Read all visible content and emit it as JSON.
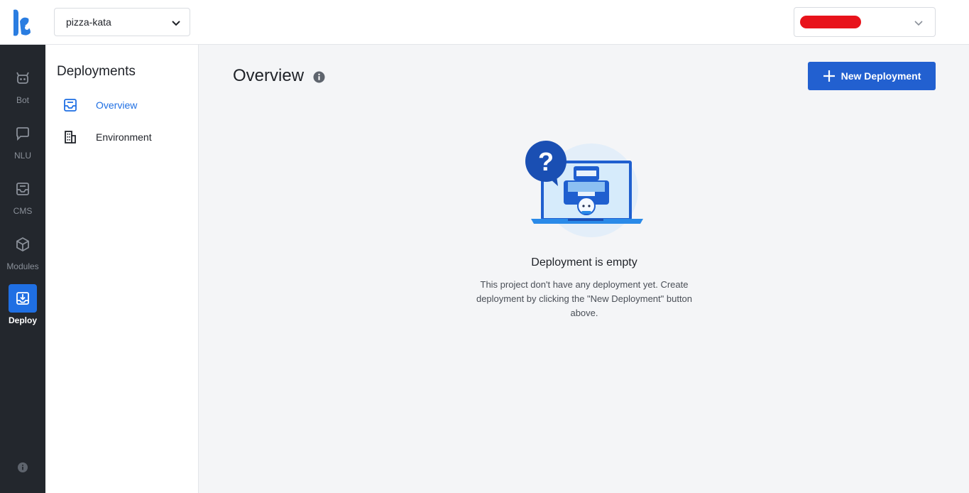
{
  "header": {
    "project": "pizza-kata",
    "user_redacted": true
  },
  "rail": {
    "items": [
      {
        "label": "Bot",
        "icon": "bot-icon"
      },
      {
        "label": "NLU",
        "icon": "chat-icon"
      },
      {
        "label": "CMS",
        "icon": "inbox-icon"
      },
      {
        "label": "Modules",
        "icon": "cube-icon"
      },
      {
        "label": "Deploy",
        "icon": "deploy-icon",
        "active": true
      }
    ]
  },
  "subnav": {
    "title": "Deployments",
    "items": [
      {
        "label": "Overview",
        "icon": "overview-icon",
        "active": true
      },
      {
        "label": "Environment",
        "icon": "building-icon"
      }
    ]
  },
  "main": {
    "title": "Overview",
    "new_button_label": "New Deployment",
    "empty_title": "Deployment is empty",
    "empty_description": "This project don't have any deployment yet. Create deployment by clicking the \"New Deployment\" button above."
  },
  "colors": {
    "accent": "#2260d0",
    "rail_bg": "#23272d",
    "active_rail": "#1f6fe3"
  }
}
